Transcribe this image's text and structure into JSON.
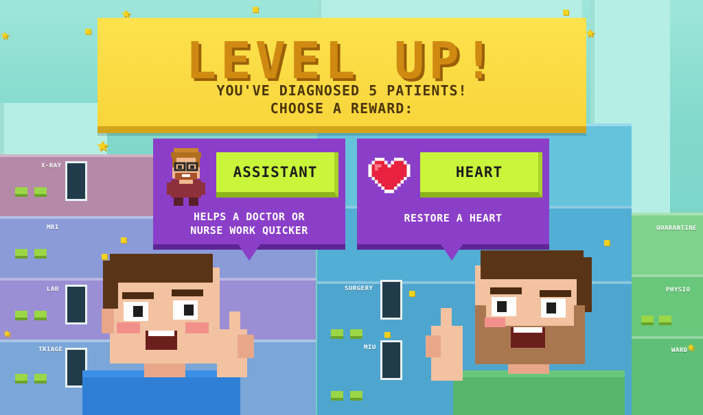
{
  "banner": {
    "title": "LEVEL UP!",
    "line1": "YOU'VE DIAGNOSED 5 PATIENTS!",
    "line2": "CHOOSE A REWARD:"
  },
  "rewards": [
    {
      "button_label": "ASSISTANT",
      "description_line1": "HELPS A DOCTOR OR",
      "description_line2": "NURSE WORK QUICKER",
      "icon": "assistant-icon"
    },
    {
      "button_label": "HEART",
      "description_line1": "RESTORE A HEART",
      "description_line2": "",
      "icon": "heart-icon"
    }
  ],
  "rooms_left": [
    "X-RAY",
    "MRI",
    "LAB",
    "TRIAGE"
  ],
  "rooms_middle": [
    "SURGERY",
    "MIU"
  ],
  "rooms_right": [
    "QUARANTINE",
    "PHYSIO",
    "WARD"
  ],
  "colors": {
    "banner_yellow": "#f8d53b",
    "title_orange": "#d08a12",
    "card_purple": "#8b3fc9",
    "button_lime": "#c9f53a"
  }
}
